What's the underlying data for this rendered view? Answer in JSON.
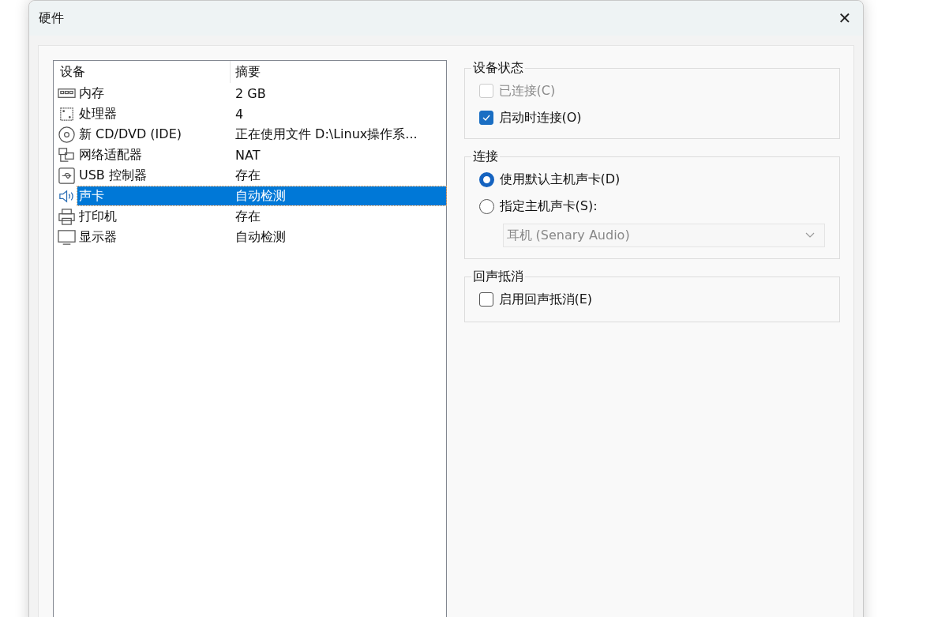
{
  "window": {
    "title": "硬件",
    "close": "✕"
  },
  "devices": {
    "columns": [
      "设备",
      "摘要"
    ],
    "rows": [
      {
        "kind": "memory",
        "name": "内存",
        "summary": "2 GB",
        "selected": false
      },
      {
        "kind": "cpu",
        "name": "处理器",
        "summary": "4",
        "selected": false
      },
      {
        "kind": "disc",
        "name": "新 CD/DVD (IDE)",
        "summary": "正在使用文件 D:\\Linux操作系...",
        "selected": false
      },
      {
        "kind": "network",
        "name": "网络适配器",
        "summary": "NAT",
        "selected": false
      },
      {
        "kind": "usb",
        "name": "USB 控制器",
        "summary": "存在",
        "selected": false
      },
      {
        "kind": "speaker",
        "name": "声卡",
        "summary": "自动检测",
        "selected": true
      },
      {
        "kind": "printer",
        "name": "打印机",
        "summary": "存在",
        "selected": false
      },
      {
        "kind": "monitor",
        "name": "显示器",
        "summary": "自动检测",
        "selected": false
      }
    ]
  },
  "groups": [
    {
      "title": "设备状态",
      "items": [
        {
          "kind": "checkbox",
          "label": "已连接(C)",
          "checked": false,
          "disabled": true
        },
        {
          "kind": "checkbox",
          "label": "启动时连接(O)",
          "checked": true,
          "disabled": false
        }
      ]
    },
    {
      "title": "连接",
      "items": [
        {
          "kind": "radio",
          "label": "使用默认主机声卡(D)",
          "selected": true
        },
        {
          "kind": "radio",
          "label": "指定主机声卡(S):",
          "selected": false
        },
        {
          "kind": "dropdown",
          "value": "耳机 (Senary Audio)",
          "disabled": true
        }
      ]
    },
    {
      "title": "回声抵消",
      "items": [
        {
          "kind": "checkbox",
          "label": "启用回声抵消(E)",
          "checked": false,
          "disabled": false
        }
      ]
    }
  ]
}
